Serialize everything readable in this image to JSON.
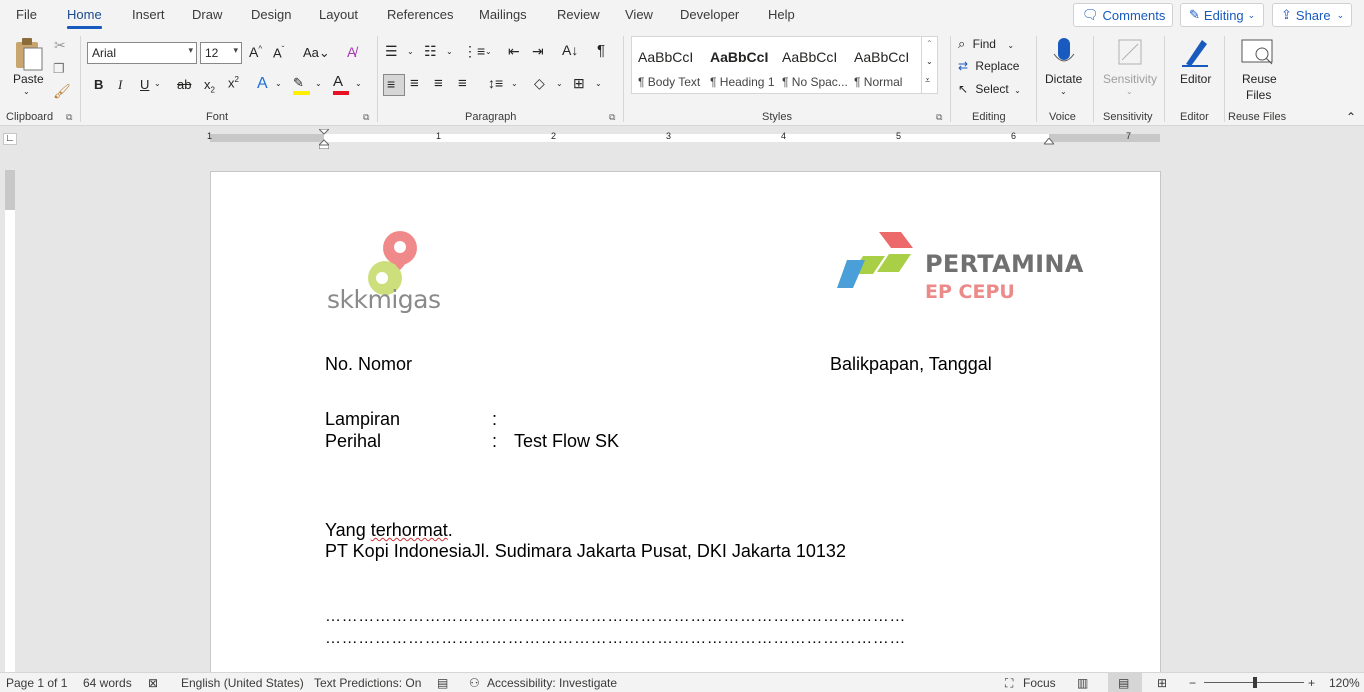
{
  "menu": {
    "tabs": [
      "File",
      "Home",
      "Insert",
      "Draw",
      "Design",
      "Layout",
      "References",
      "Mailings",
      "Review",
      "View",
      "Developer",
      "Help"
    ],
    "active_tab": "Home",
    "comments_label": "Comments",
    "editing_label": "Editing",
    "share_label": "Share"
  },
  "ribbon": {
    "clipboard": {
      "paste_label": "Paste",
      "group_label": "Clipboard"
    },
    "font": {
      "font_name": "Arial",
      "font_size": "12",
      "group_label": "Font"
    },
    "paragraph": {
      "group_label": "Paragraph"
    },
    "styles": {
      "group_label": "Styles",
      "items": [
        {
          "preview": "AaBbCcI",
          "name": "¶ Body Text"
        },
        {
          "preview": "AaBbCcI",
          "name": "¶ Heading 1"
        },
        {
          "preview": "AaBbCcI",
          "name": "¶ No Spac..."
        },
        {
          "preview": "AaBbCcI",
          "name": "¶ Normal"
        }
      ]
    },
    "editing": {
      "find_label": "Find",
      "replace_label": "Replace",
      "select_label": "Select",
      "group_label": "Editing"
    },
    "voice": {
      "dictate_label": "Dictate",
      "group_label": "Voice"
    },
    "sensitivity": {
      "label": "Sensitivity",
      "group_label": "Sensitivity"
    },
    "editor": {
      "label": "Editor",
      "group_label": "Editor"
    },
    "reuse": {
      "label_line1": "Reuse",
      "label_line2": "Files",
      "group_label": "Reuse Files"
    }
  },
  "ruler": {
    "numbers": [
      "1",
      "1",
      "2",
      "3",
      "4",
      "5",
      "6",
      "7"
    ]
  },
  "document": {
    "logo_left_text": "skkmigas",
    "logo_right_line1": "PERTAMINA",
    "logo_right_line2": "EP CEPU",
    "nomor": "No. Nomor",
    "place_date": "Balikpapan, Tanggal",
    "lampiran_label": "Lampiran",
    "lampiran_colon": ":",
    "perihal_label": "Perihal",
    "perihal_colon": ":",
    "perihal_value": "Test Flow SK",
    "greeting_word1": "Yang",
    "greeting_word2": "terhormat",
    "greeting_dot": ".",
    "address": "PT Kopi IndonesiaJl. Sudimara Jakarta Pusat, DKI Jakarta 10132",
    "dots_line1": "……………………………………………………………………………………………",
    "dots_line2": "……………………………………………………………………………………………"
  },
  "status": {
    "page": "Page 1 of 1",
    "words": "64 words",
    "language": "English (United States)",
    "predictions": "Text Predictions: On",
    "accessibility": "Accessibility: Investigate",
    "focus": "Focus",
    "zoom": "120%"
  },
  "colors": {
    "accent": "#185abd",
    "skk_pink": "#f08a8a",
    "skk_green": "#c8dc6e",
    "pertamina_blue": "#4a9fd8",
    "pertamina_green": "#a8cf45",
    "pertamina_red": "#ec6a6a"
  }
}
